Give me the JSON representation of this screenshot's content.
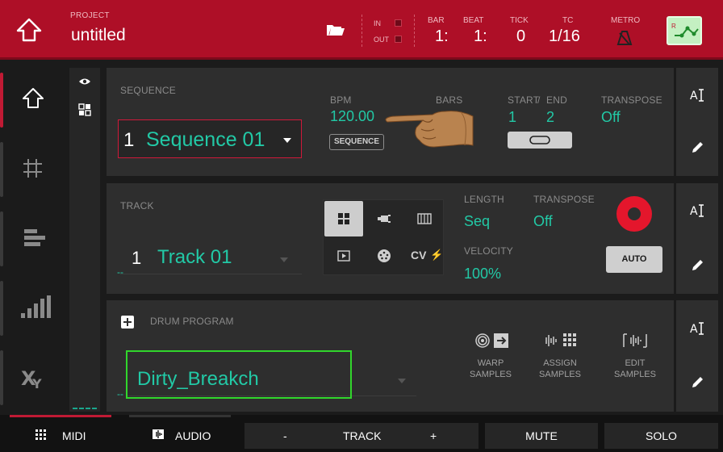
{
  "header": {
    "project_label": "PROJECT",
    "project_name": "untitled",
    "in_label": "IN",
    "out_label": "OUT",
    "bar_label": "BAR",
    "bar_value": "1:",
    "beat_label": "BEAT",
    "beat_value": "1:",
    "tick_label": "TICK",
    "tick_value": "0",
    "tc_label": "TC",
    "tc_value": "1/16",
    "metro_label": "METRO",
    "accent_color": "#ae0f27"
  },
  "sidebar": {
    "items": [
      {
        "icon": "home-icon",
        "active": true
      },
      {
        "icon": "grid-icon",
        "active": false
      },
      {
        "icon": "step-sequencer-icon",
        "active": false
      },
      {
        "icon": "mixer-bars-icon",
        "active": false
      },
      {
        "icon": "xy-icon",
        "active": false
      }
    ]
  },
  "sequence": {
    "label": "SEQUENCE",
    "number": "1",
    "name": "Sequence 01",
    "bpm_label": "BPM",
    "bpm_value": "120.00",
    "bpm_mode_button": "SEQUENCE",
    "bars_label": "BARS",
    "start_label": "START",
    "slash": "/",
    "end_label": "END",
    "start_value": "1",
    "end_value": "2",
    "transpose_label": "TRANSPOSE",
    "transpose_value": "Off"
  },
  "track": {
    "label": "TRACK",
    "number": "1",
    "name": "Track 01",
    "dash": "--",
    "cv_label": "CV",
    "length_label": "LENGTH",
    "length_value": "Seq",
    "transpose_label": "TRANSPOSE",
    "transpose_value": "Off",
    "velocity_label": "VELOCITY",
    "velocity_value": "100%",
    "auto_button": "AUTO"
  },
  "program": {
    "label": "DRUM PROGRAM",
    "name": "Dirty_Breakch",
    "dash": "--",
    "warp_label_1": "WARP",
    "warp_label_2": "SAMPLES",
    "assign_label_1": "ASSIGN",
    "assign_label_2": "SAMPLES",
    "edit_label_1": "EDIT",
    "edit_label_2": "SAMPLES"
  },
  "bottom_bar": {
    "midi": "MIDI",
    "audio": "AUDIO",
    "minus": "-",
    "track": "TRACK",
    "plus": "+",
    "mute": "MUTE",
    "solo": "SOLO"
  },
  "colors": {
    "teal_text": "#22c9a6",
    "record": "#e4162c",
    "highlight_box": "#31d62c"
  }
}
